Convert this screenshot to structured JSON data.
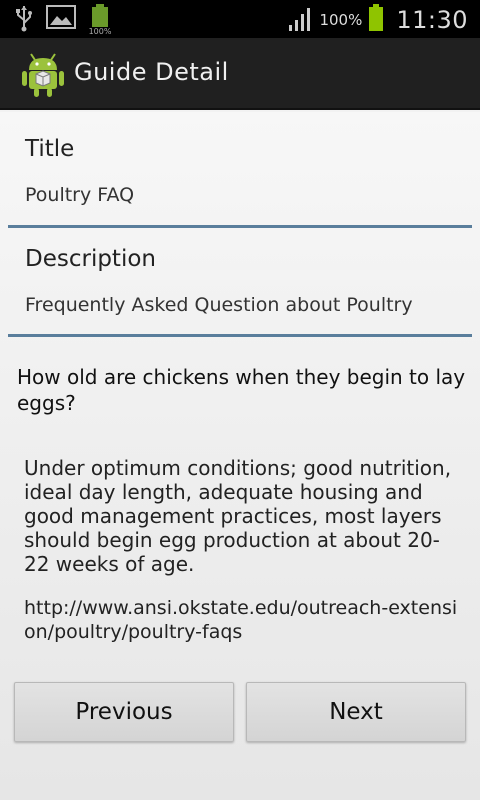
{
  "status_bar": {
    "icons_left": [
      "usb-icon",
      "image-icon",
      "battery-small-icon"
    ],
    "mini_battery_label": "100%",
    "battery_percent": "100%",
    "time": "11:30"
  },
  "action_bar": {
    "title": "Guide Detail",
    "icon": "android-app-icon"
  },
  "fields": {
    "title_label": "Title",
    "title_value": "Poultry FAQ",
    "description_label": "Description",
    "description_value": "Frequently Asked Question about Poultry"
  },
  "faq": {
    "question": "How old are chickens when they begin to lay eggs?",
    "answer": "Under optimum conditions; good nutrition, ideal day length, adequate housing and good management practices, most layers should begin egg production at about 20-22 weeks of age.",
    "link": "http://www.ansi.okstate.edu/outreach-extension/poultry/poultry-faqs"
  },
  "buttons": {
    "previous": "Previous",
    "next": "Next"
  },
  "colors": {
    "divider": "#5a7e9c",
    "android_green": "#9bc23c"
  }
}
